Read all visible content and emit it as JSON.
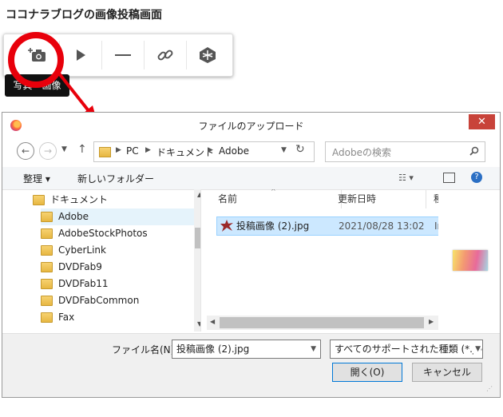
{
  "page": {
    "title": "ココナラブログの画像投稿画面"
  },
  "toolbar": {
    "buttons": [
      {
        "icon": "camera-plus-icon",
        "name": "photo-image-button"
      },
      {
        "icon": "play-icon",
        "name": "video-button"
      },
      {
        "icon": "horizontal-rule-icon",
        "name": "divider-button"
      },
      {
        "icon": "link-icon",
        "name": "link-button"
      },
      {
        "icon": "embed-icon",
        "name": "embed-button"
      }
    ],
    "tooltip": "写真・画像"
  },
  "annotation": {
    "color": "#e8000b"
  },
  "dialog": {
    "title": "ファイルのアップロード",
    "address_path": [
      "PC",
      "ドキュメント",
      "Adobe"
    ],
    "search_placeholder": "Adobeの検索",
    "organize_label": "整理 ▾",
    "new_folder_label": "新しいフォルダー",
    "tree_root": "ドキュメント",
    "tree_items": [
      "Adobe",
      "AdobeStockPhotos",
      "CyberLink",
      "DVDFab9",
      "DVDFab11",
      "DVDFabCommon",
      "Fax"
    ],
    "columns": {
      "name": "名前",
      "modified": "更新日時",
      "type": "種"
    },
    "file": {
      "name": "投稿画像 (2).jpg",
      "modified": "2021/08/28 13:02",
      "type": "Ir"
    },
    "filename_label": "ファイル名(N):",
    "filename_value": "投稿画像 (2).jpg",
    "filter_value": "すべてのサポートされた種類 (*.jpe",
    "open_label": "開く(O)",
    "cancel_label": "キャンセル"
  }
}
